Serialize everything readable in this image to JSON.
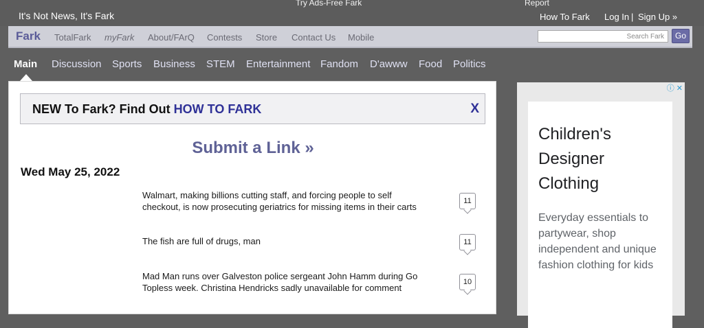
{
  "topbar": {
    "promo_ads_free": "Try Ads-Free Fark",
    "promo_report": "Report",
    "tagline": "It's Not News, It's Fark",
    "how_to_fark": "How To Fark",
    "log_in": "Log In",
    "separator": "|",
    "sign_up": "Sign Up »"
  },
  "nav": {
    "logo": "Fark",
    "items": [
      "TotalFark",
      "myFark",
      "About/FArQ",
      "Contests",
      "Store",
      "Contact Us",
      "Mobile"
    ],
    "search_placeholder": "Search Fark",
    "go_label": "Go"
  },
  "categories": [
    "Main",
    "Discussion",
    "Sports",
    "Business",
    "STEM",
    "Entertainment",
    "Fandom",
    "D'awww",
    "Food",
    "Politics"
  ],
  "banner": {
    "prefix": "NEW To Fark? Find Out ",
    "link": "HOW TO FARK",
    "close": "X"
  },
  "submit_link": "Submit a Link »",
  "date": "Wed May 25, 2022",
  "headlines": [
    {
      "text": "Walmart, making billions cutting staff, and forcing people to self checkout, is now prosecuting geriatrics for missing items in their carts",
      "comments": "11"
    },
    {
      "text": "The fish are full of drugs, man",
      "comments": "11"
    },
    {
      "text": "Mad Man runs over Galveston police sergeant John Hamm during Go Topless week. Christina Hendricks sadly unavailable for comment",
      "comments": "10"
    }
  ],
  "ad": {
    "choices": "ⓘ ✕",
    "title": "Children's Designer Clothing",
    "body": "Everyday essentials to partywear, shop independent and unique fashion clothing for kids"
  }
}
